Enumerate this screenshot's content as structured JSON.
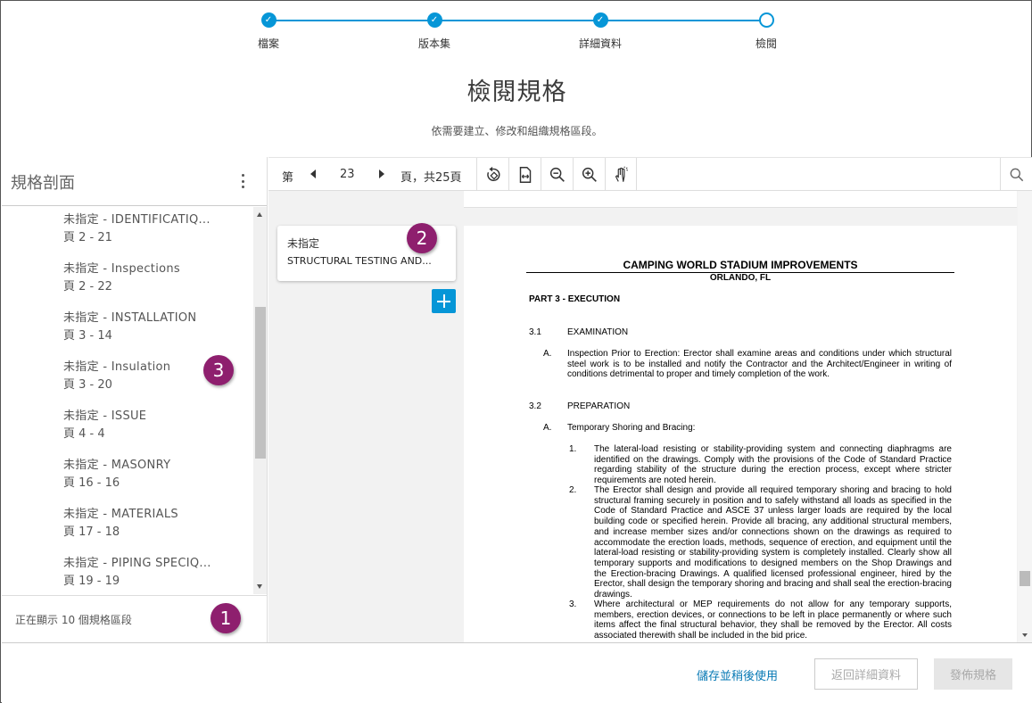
{
  "stepper": {
    "steps": [
      {
        "label": "檔案",
        "status": "complete"
      },
      {
        "label": "版本集",
        "status": "complete"
      },
      {
        "label": "詳細資料",
        "status": "complete"
      },
      {
        "label": "檢閱",
        "status": "current"
      }
    ]
  },
  "page": {
    "title": "檢閱規格",
    "subtitle": "依需要建立、修改和組織規格區段。"
  },
  "sidebar": {
    "title": "規格剖面",
    "items": [
      {
        "name": "未指定 - IDENTIFICATIQ...",
        "pages": "頁 2 - 21"
      },
      {
        "name": "未指定 - Inspections",
        "pages": "頁 2 - 22"
      },
      {
        "name": "未指定 - INSTALLATION",
        "pages": "頁 3 - 14"
      },
      {
        "name": "未指定 - Insulation",
        "pages": "頁 3 - 20"
      },
      {
        "name": "未指定 - ISSUE",
        "pages": "頁 4 - 4"
      },
      {
        "name": "未指定 - MASONRY",
        "pages": "頁 16 - 16"
      },
      {
        "name": "未指定 - MATERIALS",
        "pages": "頁 17 - 18"
      },
      {
        "name": "未指定 - PIPING SPECIQ...",
        "pages": "頁 19 - 19"
      }
    ],
    "footer": "正在顯示 10 個規格區段"
  },
  "toolbar": {
    "page_prefix": "第",
    "current_page": "23",
    "page_suffix": "頁，共25頁",
    "icons": [
      "rotate-icon",
      "fit-width-icon",
      "zoom-out-icon",
      "zoom-in-icon",
      "pan-hand-icon",
      "search-icon"
    ]
  },
  "section_card": {
    "status": "未指定",
    "title": "STRUCTURAL TESTING AND..."
  },
  "document": {
    "title": "CAMPING WORLD STADIUM IMPROVEMENTS",
    "subtitle": "ORLANDO, FL",
    "part": "PART 3 - EXECUTION",
    "s31_num": "3.1",
    "s31_head": "EXAMINATION",
    "s31_a_letter": "A.",
    "s31_a_text": "Inspection Prior to Erection:  Erector shall examine areas and conditions under which structural steel work is to be installed and notify the Contractor and the Architect/Engineer in writing of conditions detrimental to proper and timely completion of the work.",
    "s32_num": "3.2",
    "s32_head": "PREPARATION",
    "s32_a_letter": "A.",
    "s32_a_text": "Temporary Shoring and Bracing:",
    "i1_num": "1.",
    "i1_text": "The lateral-load resisting or stability-providing system and connecting diaphragms are identified on the drawings.  Comply with the provisions of the Code of Standard Practice regarding stability of the structure during the erection process, except where stricter requirements are noted herein.",
    "i2_num": "2.",
    "i2_text": "The Erector shall design and provide all required temporary shoring and bracing to hold structural framing securely in position and to safely withstand all loads as specified in the Code of Standard Practice and ASCE 37 unless larger loads are required by the local building code or specified herein.  Provide all bracing, any additional structural members, and increase member sizes and/or connections shown on the drawings as required to accommodate the erection loads, methods, sequence of erection, and equipment until the lateral-load resisting or stability-providing system is completely installed.  Clearly show all temporary supports and modifications to designed members on the Shop Drawings and the Erection-bracing Drawings.  A qualified licensed professional engineer, hired by the Erector, shall design the temporary shoring and bracing and shall seal the erection-bracing drawings.",
    "i3_num": "3.",
    "i3_text": "Where architectural or MEP requirements do not allow for any temporary supports, members, erection devices, or connections to be left in place permanently or where such items affect the final structural behavior, they shall be removed by the Erector.  All costs associated therewith shall be included in the bid price."
  },
  "badges": {
    "b1": "1",
    "b2": "2",
    "b3": "3"
  },
  "footer": {
    "save_later": "儲存並稍後使用",
    "back": "返回詳細資料",
    "publish": "發佈規格"
  },
  "colors": {
    "accent": "#0696d7",
    "badge": "#8e1f6e",
    "link": "#0678b4"
  }
}
